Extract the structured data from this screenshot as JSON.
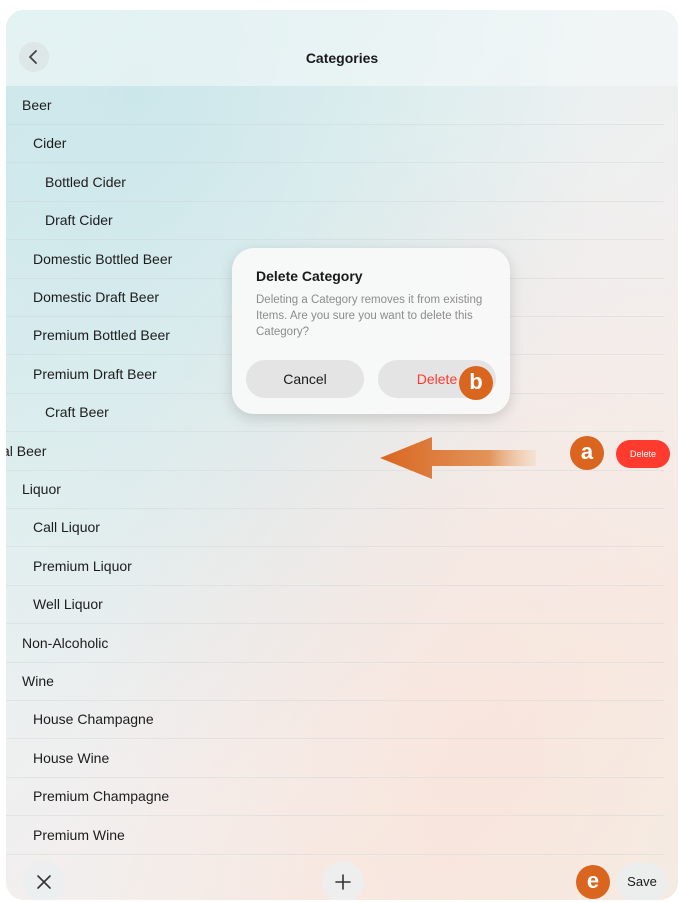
{
  "navbar": {
    "title": "Categories",
    "back_icon": "chevron-left-icon"
  },
  "categories": [
    {
      "label": "Beer",
      "level": 0
    },
    {
      "label": "Cider",
      "level": 1
    },
    {
      "label": "Bottled Cider",
      "level": 2
    },
    {
      "label": "Draft Cider",
      "level": 2
    },
    {
      "label": "Domestic Bottled Beer",
      "level": 1
    },
    {
      "label": "Domestic Draft Beer",
      "level": 1
    },
    {
      "label": "Premium Bottled Beer",
      "level": 1
    },
    {
      "label": "Premium Draft Beer",
      "level": 1
    },
    {
      "label": "Craft Beer",
      "level": 2
    },
    {
      "label": "al Beer",
      "level": 0
    },
    {
      "label": "Liquor",
      "level": 0
    },
    {
      "label": "Call Liquor",
      "level": 1
    },
    {
      "label": "Premium Liquor",
      "level": 1
    },
    {
      "label": "Well Liquor",
      "level": 1
    },
    {
      "label": "Non-Alcoholic",
      "level": 0
    },
    {
      "label": "Wine",
      "level": 0
    },
    {
      "label": "House Champagne",
      "level": 1
    },
    {
      "label": "House Wine",
      "level": 1
    },
    {
      "label": "Premium Champagne",
      "level": 1
    },
    {
      "label": "Premium Wine",
      "level": 1
    }
  ],
  "dialog": {
    "title": "Delete Category",
    "message": "Deleting a Category removes it from existing Items.  Are you sure you want to delete this Category?",
    "cancel_label": "Cancel",
    "delete_label": "Delete"
  },
  "swipe_action": {
    "delete_label": "Delete",
    "color": "#ff3b30"
  },
  "callouts": {
    "a": "a",
    "b": "b",
    "e": "e",
    "color": "#d9651f"
  },
  "toolbar": {
    "close_icon": "close-icon",
    "add_icon": "plus-icon",
    "save_label": "Save"
  }
}
